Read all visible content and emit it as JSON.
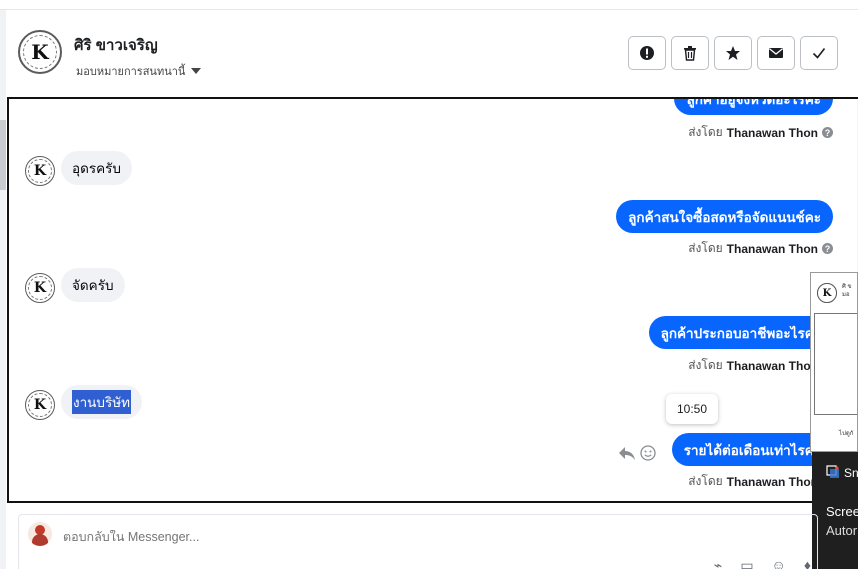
{
  "header": {
    "contact_name": "ศิริ ขาวเจริญ",
    "assign_label": "มอบหมายการสนทนานี้",
    "actions": [
      {
        "name": "spam-button",
        "icon": "alert-circle-icon"
      },
      {
        "name": "delete-button",
        "icon": "trash-icon"
      },
      {
        "name": "star-button",
        "icon": "star-icon"
      },
      {
        "name": "mark-unread-button",
        "icon": "envelope-icon"
      },
      {
        "name": "mark-done-button",
        "icon": "check-icon"
      }
    ]
  },
  "messages": [
    {
      "direction": "out",
      "text": "ลูกค้าอยู่จังหวัดอะไรคะ",
      "sent_by_prefix": "ส่งโดย",
      "sent_by_name": "Thanawan Thon"
    },
    {
      "direction": "in",
      "text": "อุดรครับ"
    },
    {
      "direction": "out",
      "text": "ลูกค้าสนใจซื้อสดหรือจัดแนนช์คะ",
      "sent_by_prefix": "ส่งโดย",
      "sent_by_name": "Thanawan Thon"
    },
    {
      "direction": "in",
      "text": "จัดครับ"
    },
    {
      "direction": "out",
      "text": "ลูกค้าประกอบอาชีพอะไรคะ",
      "sent_by_prefix": "ส่งโดย",
      "sent_by_name": "Thanawan Thon"
    },
    {
      "direction": "in",
      "text": "งานบริษัท",
      "highlighted": true
    },
    {
      "direction": "out",
      "text": "รายได้ต่อเดือนเท่าไรคะ",
      "sent_by_prefix": "ส่งโดย",
      "sent_by_name": "Thanawan Thon"
    }
  ],
  "tooltip_time": "10:50",
  "composer": {
    "placeholder": "ตอบกลับใน Messenger..."
  },
  "overlay": {
    "preview_text_1": "ศิ ข",
    "preview_text_2": "มอ",
    "preview_text_3": "ไปดูกั",
    "notif_app": "Sn",
    "notif_line1": "Scree",
    "notif_line2": "Autor"
  },
  "colors": {
    "accent": "#0866ff",
    "incoming_bubble": "#f0f2f5",
    "selection": "#2f5fd0"
  }
}
